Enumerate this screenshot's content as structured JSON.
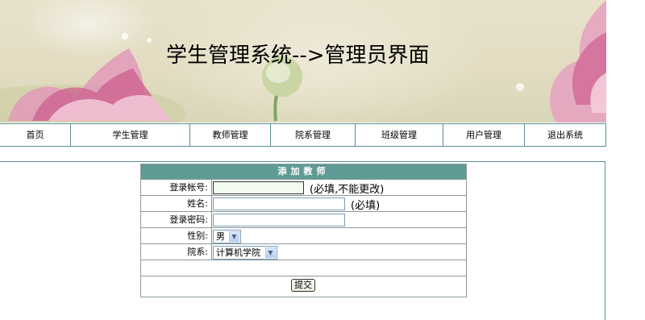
{
  "banner": {
    "title": "学生管理系统-->管理员界面"
  },
  "nav": {
    "items": [
      {
        "label": "首页"
      },
      {
        "label": "学生管理"
      },
      {
        "label": "教师管理"
      },
      {
        "label": "院系管理"
      },
      {
        "label": "班级管理"
      },
      {
        "label": "用户管理"
      },
      {
        "label": "退出系统"
      }
    ]
  },
  "form": {
    "heading": "添加教师",
    "account": {
      "label": "登录帐号:",
      "value": "",
      "hint": "(必填,不能更改)"
    },
    "name": {
      "label": "姓名:",
      "value": "",
      "hint": "(必填)"
    },
    "password": {
      "label": "登录密码:",
      "value": ""
    },
    "gender": {
      "label": "性别:",
      "selected": "男"
    },
    "department": {
      "label": "院系:",
      "selected": "计算机学院"
    },
    "submit_label": "提交"
  },
  "colors": {
    "accent": "#5f9b95",
    "border": "#5b8f94",
    "lotus_pink": "#d46a9a"
  },
  "icons": {
    "dropdown": "chevron-down-icon"
  }
}
